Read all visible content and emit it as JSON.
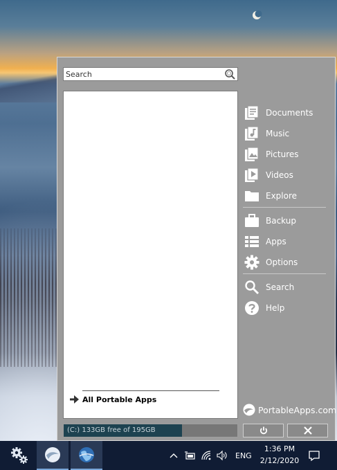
{
  "search": {
    "placeholder": "Search",
    "value": ""
  },
  "app_list": {
    "all_apps_label": "All Portable Apps"
  },
  "drive": {
    "label": "(C:) 133GB free of 195GB",
    "free_fraction": 0.682
  },
  "side_menu": {
    "group1": [
      {
        "label": "Documents",
        "icon": "documents-icon"
      },
      {
        "label": "Music",
        "icon": "music-icon"
      },
      {
        "label": "Pictures",
        "icon": "pictures-icon"
      },
      {
        "label": "Videos",
        "icon": "videos-icon"
      },
      {
        "label": "Explore",
        "icon": "folder-icon"
      }
    ],
    "group2": [
      {
        "label": "Backup",
        "icon": "briefcase-icon"
      },
      {
        "label": "Apps",
        "icon": "list-icon"
      },
      {
        "label": "Options",
        "icon": "gear-icon"
      }
    ],
    "group3": [
      {
        "label": "Search",
        "icon": "search-icon"
      },
      {
        "label": "Help",
        "icon": "help-icon"
      }
    ]
  },
  "brand": {
    "text": "PortableApps.com"
  },
  "taskbar": {
    "language": "ENG",
    "time": "1:36 PM",
    "date": "2/12/2020"
  },
  "colors": {
    "menu_bg": "#9b9b9b",
    "taskbar_bg": "#101c34",
    "drive_fill": "#1d4250"
  }
}
